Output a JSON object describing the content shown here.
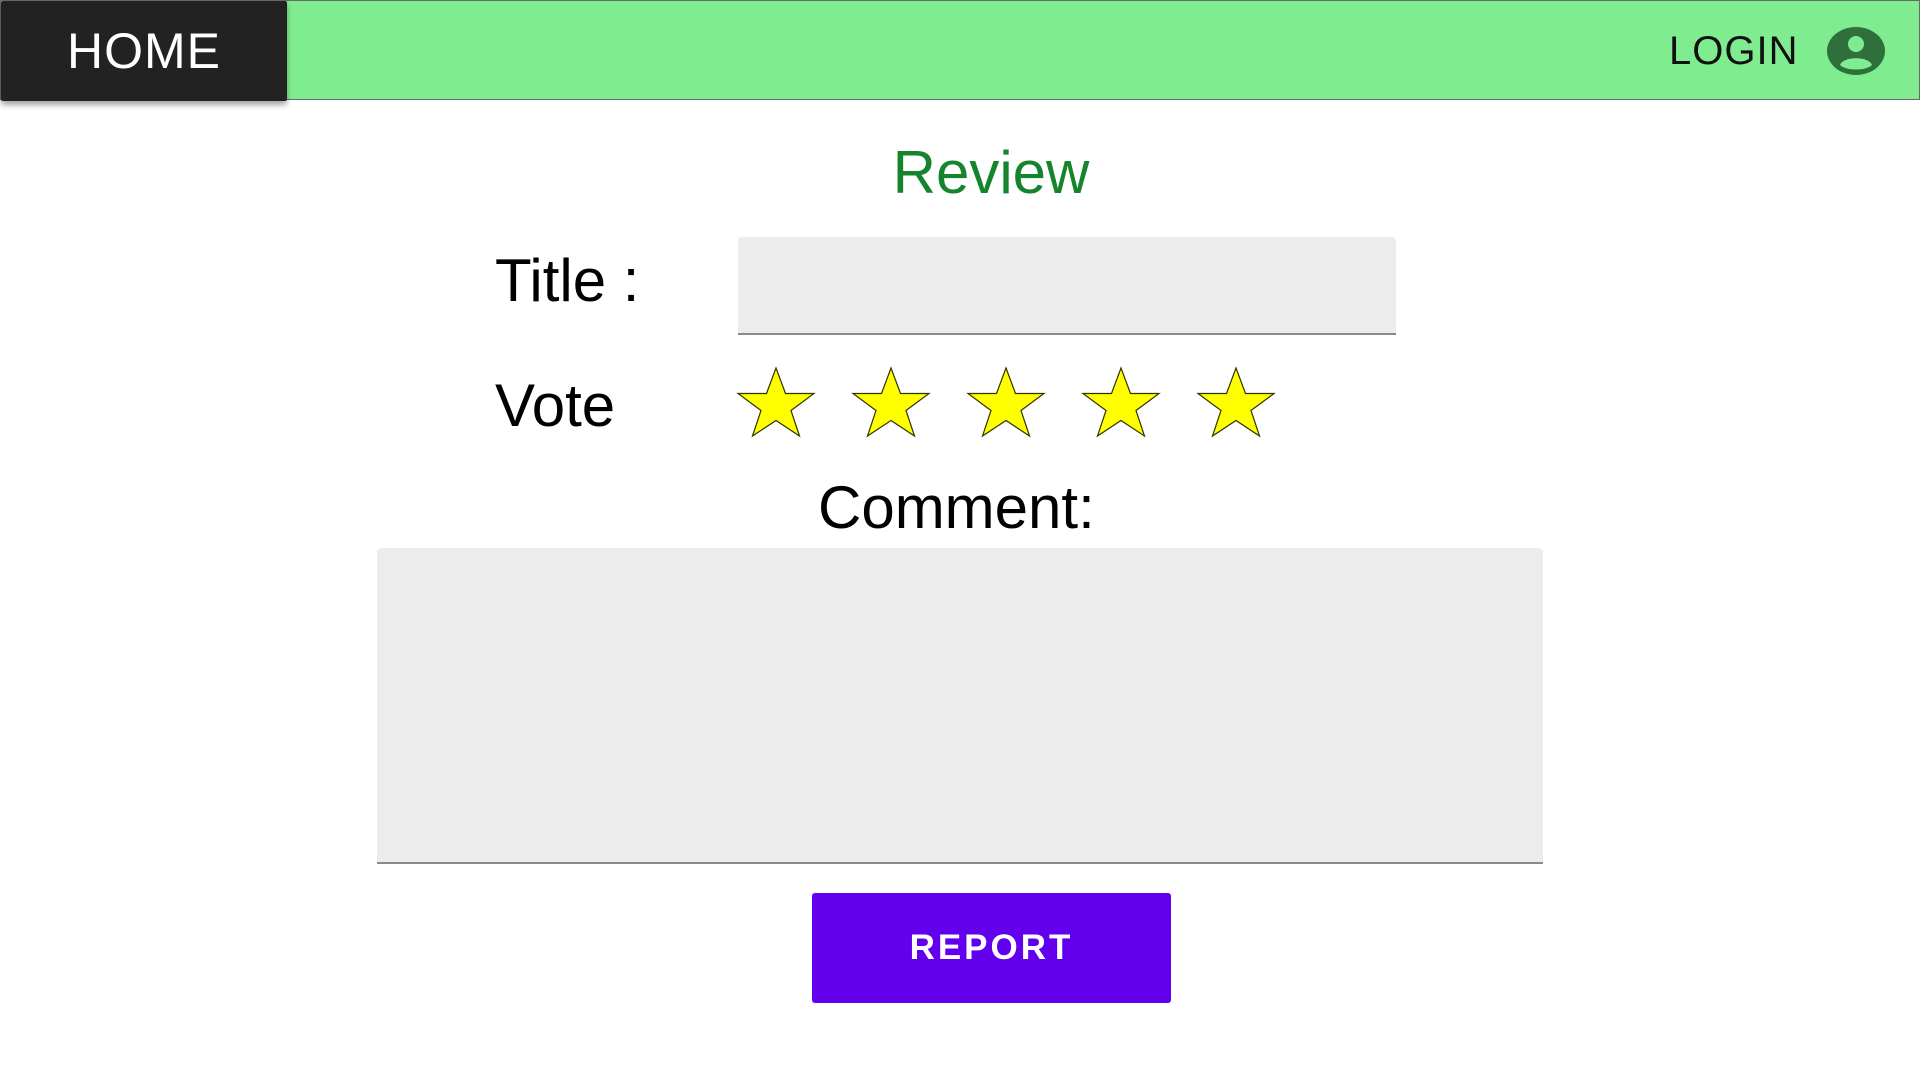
{
  "navbar": {
    "home_label": "HOME",
    "login_label": "LOGIN",
    "account_icon": "account-circle-icon",
    "background_color": "#80ec90",
    "home_tab_color": "#222222"
  },
  "form": {
    "heading": "Review",
    "heading_color": "#15842d",
    "title_label": "Title :",
    "title_value": "",
    "vote_label": "Vote",
    "vote": {
      "max_stars": 5,
      "star_icon": "star-icon",
      "star_color": "#ffff00"
    },
    "comment_label": "Comment:",
    "comment_value": "",
    "submit_label": "REPORT",
    "submit_color": "#6200ee",
    "field_background": "#ececec"
  }
}
